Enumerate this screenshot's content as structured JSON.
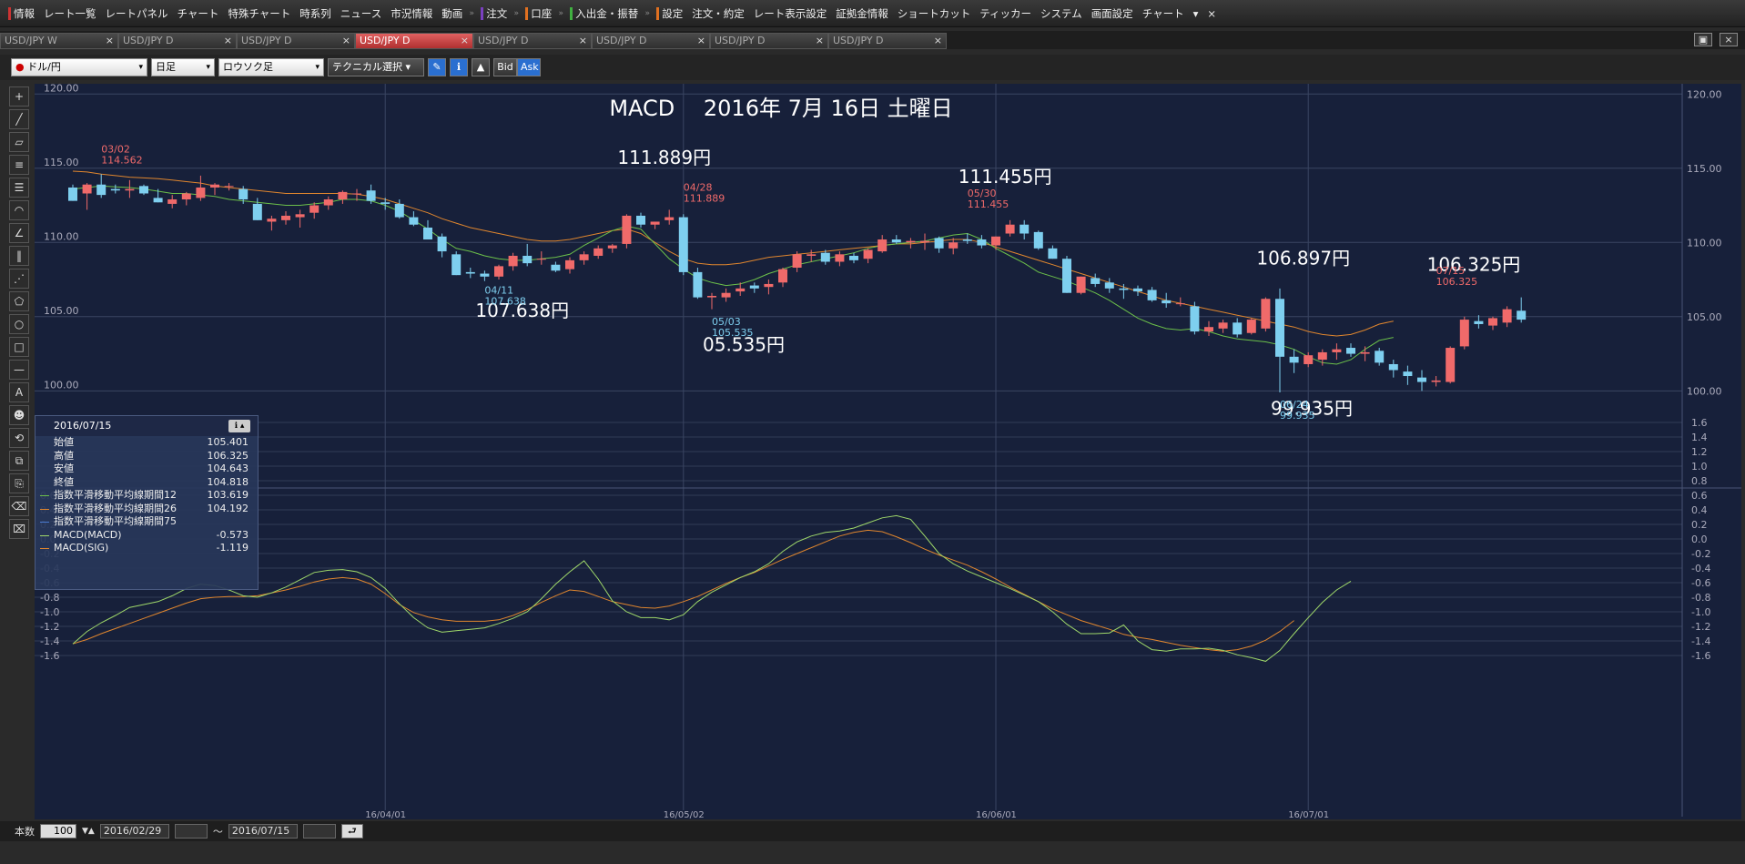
{
  "menu": {
    "items": [
      {
        "label": "情報",
        "mark": "#cc3333"
      },
      {
        "label": "レート一覧"
      },
      {
        "label": "レートパネル"
      },
      {
        "label": "チャート"
      },
      {
        "label": "特殊チャート"
      },
      {
        "label": "時系列"
      },
      {
        "label": "ニュース"
      },
      {
        "label": "市況情報"
      },
      {
        "label": "動画"
      },
      {
        "label": "注文",
        "mark": "#7a40c0",
        "sep": true
      },
      {
        "label": "口座",
        "mark": "#e07020",
        "sep": true
      },
      {
        "label": "入出金・振替",
        "mark": "#40b040",
        "sep": true
      },
      {
        "label": "設定",
        "mark": "#e07020",
        "sep": true
      },
      {
        "label": "注文・約定"
      },
      {
        "label": "レート表示設定"
      },
      {
        "label": "証拠金情報"
      },
      {
        "label": "ショートカット"
      },
      {
        "label": "ティッカー"
      },
      {
        "label": "システム"
      },
      {
        "label": "画面設定"
      },
      {
        "label": "チャート"
      }
    ],
    "more": "▾",
    "close": "×"
  },
  "tabs": [
    {
      "label": "USD/JPY W"
    },
    {
      "label": "USD/JPY D"
    },
    {
      "label": "USD/JPY D"
    },
    {
      "label": "USD/JPY D",
      "active": true
    },
    {
      "label": "USD/JPY D"
    },
    {
      "label": "USD/JPY D"
    },
    {
      "label": "USD/JPY D"
    },
    {
      "label": "USD/JPY D"
    }
  ],
  "tab_close": "×",
  "window_buttons": {
    "restore": "▣",
    "close": "×"
  },
  "toolbar": {
    "pair": "ドル/円",
    "interval": "日足",
    "chart_type": "ロウソク足",
    "technical": "テクニカル選択",
    "caret": "▾",
    "bid": "Bid",
    "ask": "Ask"
  },
  "left_tools": [
    {
      "name": "crosshair",
      "glyph": "+"
    },
    {
      "name": "trendline",
      "glyph": "╱"
    },
    {
      "name": "ruler",
      "glyph": "▱"
    },
    {
      "name": "hline",
      "glyph": "≡"
    },
    {
      "name": "channel",
      "glyph": "☰"
    },
    {
      "name": "fan",
      "glyph": "◠"
    },
    {
      "name": "gann",
      "glyph": "∠"
    },
    {
      "name": "vlines",
      "glyph": "‖"
    },
    {
      "name": "pitchfork",
      "glyph": "⋰"
    },
    {
      "name": "pentagon",
      "glyph": "⬠"
    },
    {
      "name": "circle",
      "glyph": "○"
    },
    {
      "name": "rect",
      "glyph": "□"
    },
    {
      "name": "dash",
      "glyph": "—"
    },
    {
      "name": "text",
      "glyph": "A"
    },
    {
      "name": "icon",
      "glyph": "☻"
    },
    {
      "name": "undo",
      "glyph": "⟲"
    },
    {
      "name": "copy",
      "glyph": "⧉"
    },
    {
      "name": "paste",
      "glyph": "⎘"
    },
    {
      "name": "eraser",
      "glyph": "⌫"
    },
    {
      "name": "eraseall",
      "glyph": "⌧"
    }
  ],
  "chart": {
    "title": "MACD　 2016年 7月 16日 土曜日",
    "price_ticks": [
      "120.00",
      "115.00",
      "110.00",
      "105.00",
      "100.00"
    ],
    "price_tick_values": [
      120,
      115,
      110,
      105,
      100
    ],
    "price_range": [
      99.1,
      120.2
    ],
    "macd_ticks": [
      "1.6",
      "1.4",
      "1.2",
      "1.0",
      "0.8",
      "0.6",
      "0.4",
      "0.2",
      "0.0",
      "-0.2",
      "-0.4",
      "-0.6",
      "-0.8",
      "-1.0",
      "-1.2",
      "-1.4",
      "-1.6"
    ],
    "macd_tick_values": [
      1.6,
      1.4,
      1.2,
      1.0,
      0.8,
      0.6,
      0.4,
      0.2,
      0.0,
      -0.2,
      -0.4,
      -0.6,
      -0.8,
      -1.0,
      -1.2,
      -1.4,
      -1.6
    ],
    "left_macd_ticks": [
      "0.6",
      "0.4",
      "0.2",
      "0.0",
      "-0.2",
      "-0.4",
      "-0.6",
      "-0.8",
      "-1.0",
      "-1.2",
      "-1.4",
      "-1.6"
    ],
    "left_macd_tick_values": [
      0.6,
      0.4,
      0.2,
      0.0,
      -0.2,
      -0.4,
      -0.6,
      -0.8,
      -1.0,
      -1.2,
      -1.4,
      -1.6
    ],
    "macd_range": [
      -1.75,
      1.75
    ],
    "date_labels": [
      {
        "label": "16/04/01",
        "idx": 22
      },
      {
        "label": "16/05/02",
        "idx": 43
      },
      {
        "label": "16/06/01",
        "idx": 65
      },
      {
        "label": "16/07/01",
        "idx": 87
      }
    ],
    "colors": {
      "up": "#f06a6a",
      "down": "#7ecfef",
      "ema12": "#6cc04a",
      "ema26": "#e0862e",
      "macd": "#9fd86a",
      "sig": "#e0862e",
      "grid": "#3a4562",
      "bg": "#17203a"
    },
    "ema12": [
      113.6,
      113.7,
      113.8,
      113.75,
      113.7,
      113.6,
      113.45,
      113.3,
      113.3,
      113.2,
      113.1,
      112.9,
      112.8,
      112.7,
      112.6,
      112.5,
      112.5,
      112.6,
      112.7,
      112.9,
      112.9,
      112.8,
      112.5,
      112.1,
      111.5,
      110.9,
      110.2,
      109.6,
      109.4,
      109.1,
      108.9,
      108.8,
      108.8,
      108.9,
      109.0,
      109.2,
      109.8,
      110.3,
      110.8,
      111.1,
      110.9,
      109.9,
      108.9,
      108.2,
      107.6,
      107.3,
      107.1,
      107.2,
      107.5,
      107.9,
      108.2,
      108.5,
      108.7,
      108.9,
      109.1,
      109.3,
      109.6,
      109.8,
      109.9,
      110.0,
      110.1,
      110.3,
      110.5,
      110.6,
      110.2,
      109.6,
      109.1,
      108.6,
      108.0,
      107.7,
      107.4,
      107.0,
      106.6,
      106.1,
      105.5,
      104.9,
      104.5,
      104.2,
      104.1,
      104.2,
      104.0,
      103.7,
      103.5,
      103.4,
      103.3,
      103.1,
      102.8,
      102.3,
      101.9,
      101.8,
      102.1,
      102.8,
      103.4,
      103.6
    ],
    "ema26": [
      114.8,
      114.75,
      114.6,
      114.5,
      114.4,
      114.35,
      114.3,
      114.2,
      114.1,
      114.0,
      113.8,
      113.7,
      113.6,
      113.5,
      113.4,
      113.3,
      113.3,
      113.3,
      113.3,
      113.3,
      113.25,
      113.1,
      112.9,
      112.6,
      112.3,
      112.0,
      111.6,
      111.3,
      111.0,
      110.8,
      110.6,
      110.4,
      110.2,
      110.1,
      110.1,
      110.2,
      110.4,
      110.6,
      110.8,
      110.9,
      110.6,
      110.0,
      109.4,
      108.9,
      108.6,
      108.5,
      108.5,
      108.6,
      108.8,
      109.0,
      109.1,
      109.2,
      109.3,
      109.4,
      109.5,
      109.6,
      109.7,
      109.8,
      109.9,
      109.9,
      110.0,
      110.1,
      110.2,
      110.2,
      110.0,
      109.7,
      109.4,
      109.1,
      108.8,
      108.5,
      108.2,
      107.9,
      107.6,
      107.3,
      107.0,
      106.7,
      106.4,
      106.1,
      105.9,
      105.7,
      105.5,
      105.3,
      105.1,
      104.9,
      104.7,
      104.5,
      104.3,
      104.0,
      103.8,
      103.7,
      103.8,
      104.1,
      104.5,
      104.7
    ],
    "macd": [
      -1.44,
      -1.27,
      -1.15,
      -1.05,
      -0.94,
      -0.9,
      -0.86,
      -0.78,
      -0.68,
      -0.62,
      -0.64,
      -0.7,
      -0.78,
      -0.8,
      -0.74,
      -0.66,
      -0.56,
      -0.46,
      -0.43,
      -0.42,
      -0.45,
      -0.53,
      -0.68,
      -0.89,
      -1.08,
      -1.22,
      -1.28,
      -1.26,
      -1.24,
      -1.22,
      -1.16,
      -1.09,
      -1.0,
      -0.82,
      -0.62,
      -0.45,
      -0.3,
      -0.55,
      -0.85,
      -1.0,
      -1.08,
      -1.08,
      -1.11,
      -1.04,
      -0.86,
      -0.73,
      -0.63,
      -0.53,
      -0.45,
      -0.34,
      -0.17,
      -0.04,
      0.04,
      0.09,
      0.11,
      0.15,
      0.22,
      0.29,
      0.32,
      0.27,
      0.04,
      -0.2,
      -0.34,
      -0.44,
      -0.52,
      -0.6,
      -0.68,
      -0.77,
      -0.86,
      -1.0,
      -1.17,
      -1.3,
      -1.3,
      -1.29,
      -1.18,
      -1.4,
      -1.52,
      -1.54,
      -1.51,
      -1.51,
      -1.5,
      -1.53,
      -1.59,
      -1.63,
      -1.68,
      -1.53,
      -1.3,
      -1.08,
      -0.87,
      -0.7,
      -0.58
    ],
    "sig": [
      -1.44,
      -1.38,
      -1.3,
      -1.23,
      -1.16,
      -1.09,
      -1.02,
      -0.95,
      -0.88,
      -0.82,
      -0.8,
      -0.79,
      -0.79,
      -0.78,
      -0.74,
      -0.7,
      -0.65,
      -0.59,
      -0.55,
      -0.53,
      -0.55,
      -0.62,
      -0.75,
      -0.9,
      -1.01,
      -1.07,
      -1.11,
      -1.13,
      -1.13,
      -1.13,
      -1.11,
      -1.05,
      -0.97,
      -0.87,
      -0.78,
      -0.7,
      -0.72,
      -0.79,
      -0.86,
      -0.9,
      -0.94,
      -0.95,
      -0.92,
      -0.86,
      -0.79,
      -0.7,
      -0.61,
      -0.53,
      -0.46,
      -0.37,
      -0.28,
      -0.2,
      -0.12,
      -0.04,
      0.04,
      0.09,
      0.12,
      0.1,
      0.03,
      -0.05,
      -0.14,
      -0.22,
      -0.29,
      -0.36,
      -0.45,
      -0.55,
      -0.66,
      -0.76,
      -0.86,
      -0.96,
      -1.04,
      -1.12,
      -1.18,
      -1.24,
      -1.31,
      -1.35,
      -1.38,
      -1.42,
      -1.46,
      -1.49,
      -1.52,
      -1.54,
      -1.52,
      -1.47,
      -1.39,
      -1.27,
      -1.12
    ],
    "candles": [
      [
        113.7,
        113.9,
        112.8,
        112.8
      ],
      [
        113.3,
        114.0,
        112.2,
        113.9
      ],
      [
        113.9,
        114.6,
        113.0,
        113.2
      ],
      [
        113.6,
        113.9,
        113.3,
        113.5
      ],
      [
        113.5,
        114.2,
        113.0,
        113.6
      ],
      [
        113.8,
        113.9,
        113.2,
        113.3
      ],
      [
        113.0,
        113.6,
        112.7,
        112.7
      ],
      [
        112.6,
        113.2,
        112.3,
        112.9
      ],
      [
        112.9,
        113.4,
        112.5,
        113.3
      ],
      [
        113.0,
        114.5,
        112.8,
        113.7
      ],
      [
        113.7,
        114.0,
        113.2,
        113.9
      ],
      [
        113.8,
        114.0,
        113.5,
        113.8
      ],
      [
        113.6,
        113.8,
        112.6,
        112.9
      ],
      [
        112.6,
        113.0,
        111.5,
        111.5
      ],
      [
        111.4,
        111.8,
        110.8,
        111.6
      ],
      [
        111.5,
        112.1,
        111.2,
        111.8
      ],
      [
        111.7,
        112.2,
        111.0,
        111.9
      ],
      [
        112.0,
        112.7,
        111.6,
        112.5
      ],
      [
        112.5,
        113.1,
        112.2,
        112.9
      ],
      [
        112.9,
        113.5,
        112.6,
        113.4
      ],
      [
        113.3,
        113.6,
        112.8,
        113.3
      ],
      [
        113.5,
        113.9,
        112.6,
        112.8
      ],
      [
        112.7,
        113.0,
        112.2,
        112.6
      ],
      [
        112.6,
        112.9,
        111.6,
        111.7
      ],
      [
        111.7,
        112.1,
        111.1,
        111.2
      ],
      [
        111.0,
        111.5,
        110.2,
        110.2
      ],
      [
        110.4,
        110.6,
        109.0,
        109.4
      ],
      [
        109.2,
        109.4,
        107.8,
        107.8
      ],
      [
        108.0,
        108.3,
        107.6,
        107.9
      ],
      [
        107.9,
        108.1,
        107.4,
        107.7
      ],
      [
        107.7,
        108.5,
        107.5,
        108.4
      ],
      [
        108.4,
        109.3,
        108.1,
        109.1
      ],
      [
        109.1,
        109.9,
        108.4,
        108.6
      ],
      [
        108.9,
        109.4,
        108.5,
        108.9
      ],
      [
        108.5,
        108.7,
        108.0,
        108.1
      ],
      [
        108.2,
        109.0,
        107.9,
        108.8
      ],
      [
        108.8,
        109.4,
        108.5,
        109.2
      ],
      [
        109.1,
        109.8,
        108.9,
        109.6
      ],
      [
        109.6,
        109.9,
        109.3,
        109.8
      ],
      [
        109.9,
        111.9,
        109.6,
        111.8
      ],
      [
        111.8,
        112.0,
        111.0,
        111.2
      ],
      [
        111.2,
        111.4,
        110.9,
        111.4
      ],
      [
        111.5,
        112.2,
        111.2,
        111.7
      ],
      [
        111.7,
        111.9,
        107.8,
        108.0
      ],
      [
        108.0,
        108.3,
        106.2,
        106.3
      ],
      [
        106.3,
        106.6,
        105.5,
        106.4
      ],
      [
        106.3,
        106.9,
        106.0,
        106.6
      ],
      [
        106.7,
        107.3,
        106.4,
        106.9
      ],
      [
        107.1,
        107.3,
        106.6,
        106.9
      ],
      [
        107.0,
        107.5,
        106.5,
        107.2
      ],
      [
        107.3,
        108.3,
        107.0,
        108.2
      ],
      [
        108.3,
        109.4,
        108.0,
        109.2
      ],
      [
        109.1,
        109.5,
        108.7,
        109.2
      ],
      [
        109.3,
        109.5,
        108.5,
        108.7
      ],
      [
        108.7,
        109.4,
        108.4,
        109.2
      ],
      [
        109.1,
        109.3,
        108.6,
        108.8
      ],
      [
        108.9,
        109.6,
        108.6,
        109.5
      ],
      [
        109.4,
        110.5,
        109.3,
        110.2
      ],
      [
        110.2,
        110.5,
        109.9,
        110.0
      ],
      [
        110.0,
        110.3,
        109.6,
        110.1
      ],
      [
        110.0,
        110.6,
        109.5,
        110.1
      ],
      [
        110.3,
        110.4,
        109.3,
        109.6
      ],
      [
        109.6,
        110.3,
        109.2,
        110.0
      ],
      [
        110.2,
        110.6,
        109.9,
        110.1
      ],
      [
        110.2,
        110.5,
        109.6,
        109.8
      ],
      [
        109.8,
        110.4,
        109.5,
        110.4
      ],
      [
        110.6,
        111.5,
        110.4,
        111.2
      ],
      [
        111.2,
        111.5,
        110.2,
        110.6
      ],
      [
        110.7,
        110.8,
        109.5,
        109.6
      ],
      [
        109.6,
        109.8,
        108.9,
        108.9
      ],
      [
        108.9,
        109.1,
        106.6,
        106.6
      ],
      [
        106.6,
        107.7,
        106.5,
        107.7
      ],
      [
        107.6,
        107.9,
        107.0,
        107.2
      ],
      [
        107.3,
        107.6,
        106.6,
        106.9
      ],
      [
        106.9,
        107.2,
        106.2,
        106.8
      ],
      [
        106.9,
        107.1,
        106.4,
        106.7
      ],
      [
        106.8,
        107.0,
        106.0,
        106.1
      ],
      [
        106.1,
        106.6,
        105.6,
        105.9
      ],
      [
        105.9,
        106.3,
        105.7,
        105.9
      ],
      [
        105.7,
        106.0,
        103.8,
        104.0
      ],
      [
        104.0,
        104.7,
        103.7,
        104.3
      ],
      [
        104.2,
        104.8,
        103.9,
        104.6
      ],
      [
        104.6,
        104.9,
        103.6,
        103.8
      ],
      [
        103.9,
        104.9,
        103.8,
        104.8
      ],
      [
        104.2,
        106.3,
        104.0,
        106.2
      ],
      [
        106.2,
        106.9,
        99.9,
        102.3
      ],
      [
        102.3,
        102.8,
        101.2,
        101.9
      ],
      [
        101.8,
        102.6,
        101.6,
        102.4
      ],
      [
        102.1,
        102.8,
        101.7,
        102.6
      ],
      [
        102.6,
        103.2,
        102.1,
        102.8
      ],
      [
        102.9,
        103.2,
        102.3,
        102.5
      ],
      [
        102.5,
        103.0,
        102.0,
        102.6
      ],
      [
        102.7,
        102.9,
        101.7,
        101.9
      ],
      [
        101.8,
        102.1,
        100.9,
        101.4
      ],
      [
        101.3,
        101.7,
        100.4,
        101.0
      ],
      [
        100.9,
        101.4,
        100.0,
        100.6
      ],
      [
        100.6,
        101.0,
        100.3,
        100.7
      ],
      [
        100.6,
        103.0,
        100.5,
        102.9
      ],
      [
        103.0,
        105.0,
        102.8,
        104.8
      ],
      [
        104.7,
        105.1,
        104.2,
        104.5
      ],
      [
        104.4,
        105.0,
        104.1,
        104.9
      ],
      [
        104.6,
        105.7,
        104.3,
        105.5
      ],
      [
        105.4,
        106.3,
        104.6,
        104.8
      ]
    ]
  },
  "annotations": {
    "big": [
      {
        "text": "111.889円",
        "idx": 39,
        "price": 115.3
      },
      {
        "text": "111.455円",
        "idx": 63,
        "price": 114.0
      },
      {
        "text": "107.638円",
        "idx": 29,
        "price": 105.0
      },
      {
        "text": "05.535円",
        "idx": 45,
        "price": 102.7
      },
      {
        "text": "106.897円",
        "idx": 84,
        "price": 108.5
      },
      {
        "text": "99.935円",
        "idx": 85,
        "price": 98.4
      },
      {
        "text": "106.325円",
        "idx": 96,
        "price": 108.1
      }
    ],
    "small": [
      {
        "d": "03/02",
        "p": "114.562",
        "idx": 2,
        "price": 114.6,
        "up": true
      },
      {
        "d": "04/28",
        "p": "111.889",
        "idx": 43,
        "price": 112.0,
        "up": true
      },
      {
        "d": "05/30",
        "p": "111.455",
        "idx": 63,
        "price": 111.6,
        "up": true
      },
      {
        "d": "04/11",
        "p": "107.638",
        "idx": 29,
        "price": 107.4,
        "up": false
      },
      {
        "d": "05/03",
        "p": "105.535",
        "idx": 45,
        "price": 105.3,
        "up": false
      },
      {
        "d": "06/24",
        "p": "99.935",
        "idx": 85,
        "price": 99.7,
        "up": false
      },
      {
        "d": "07/15",
        "p": "106.325",
        "idx": 96,
        "price": 106.4,
        "up": true
      }
    ]
  },
  "info": {
    "date": "2016/07/15",
    "rows": [
      {
        "label": "始値",
        "value": "105.401"
      },
      {
        "label": "高値",
        "value": "106.325"
      },
      {
        "label": "安値",
        "value": "104.643"
      },
      {
        "label": "終値",
        "value": "104.818"
      },
      {
        "label": "指数平滑移動平均線期間12",
        "value": "103.619",
        "color": "#6cc04a"
      },
      {
        "label": "指数平滑移動平均線期間26",
        "value": "104.192",
        "color": "#e0862e"
      },
      {
        "label": "指数平滑移動平均線期間75",
        "value": "",
        "color": "#4a7ad0"
      },
      {
        "label": "MACD(MACD)",
        "value": "-0.573",
        "color": "#9fd86a"
      },
      {
        "label": "MACD(SIG)",
        "value": "-1.119",
        "color": "#e0862e"
      }
    ]
  },
  "bottom": {
    "count_label": "本数",
    "count": "100",
    "start": "2016/02/29",
    "tilde": "～",
    "end": "2016/07/15",
    "go": "⮐"
  },
  "chart_data": {
    "type": "candlestick",
    "title": "MACD　 2016年 7月 16日 土曜日",
    "note": "USD/JPY daily with EMA12/EMA26 and MACD panel"
  }
}
